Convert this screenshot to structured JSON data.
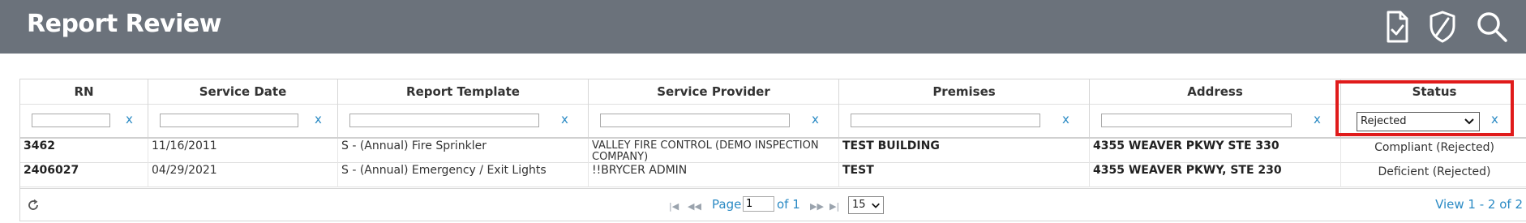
{
  "header": {
    "title": "Report Review"
  },
  "toolbar_icons": [
    "report-check-icon",
    "shield-icon",
    "search-icon"
  ],
  "columns": [
    "RN",
    "Service Date",
    "Report Template",
    "Service Provider",
    "Premises",
    "Address",
    "Status"
  ],
  "filters": {
    "clear_label": "x",
    "status_value": "Rejected"
  },
  "rows": [
    [
      "3462",
      "11/16/2011",
      "S - (Annual) Fire Sprinkler",
      "VALLEY FIRE CONTROL (DEMO INSPECTION COMPANY)",
      "TEST BUILDING",
      "4355 WEAVER PKWY STE 330",
      "Compliant (Rejected)"
    ],
    [
      "2406027",
      "04/29/2021",
      "S - (Annual) Emergency / Exit Lights",
      "!!BRYCER ADMIN",
      "TEST",
      "4355 WEAVER PKWY, STE 230",
      "Deficient (Rejected)"
    ]
  ],
  "pager": {
    "page_label": "Page",
    "page_value": "1",
    "of_label": "of 1",
    "page_size": "15",
    "view_text": "View 1 - 2 of 2"
  },
  "colors": {
    "topbar": "#6b727b",
    "link": "#2a8ac4",
    "highlight": "#e01b1b"
  }
}
